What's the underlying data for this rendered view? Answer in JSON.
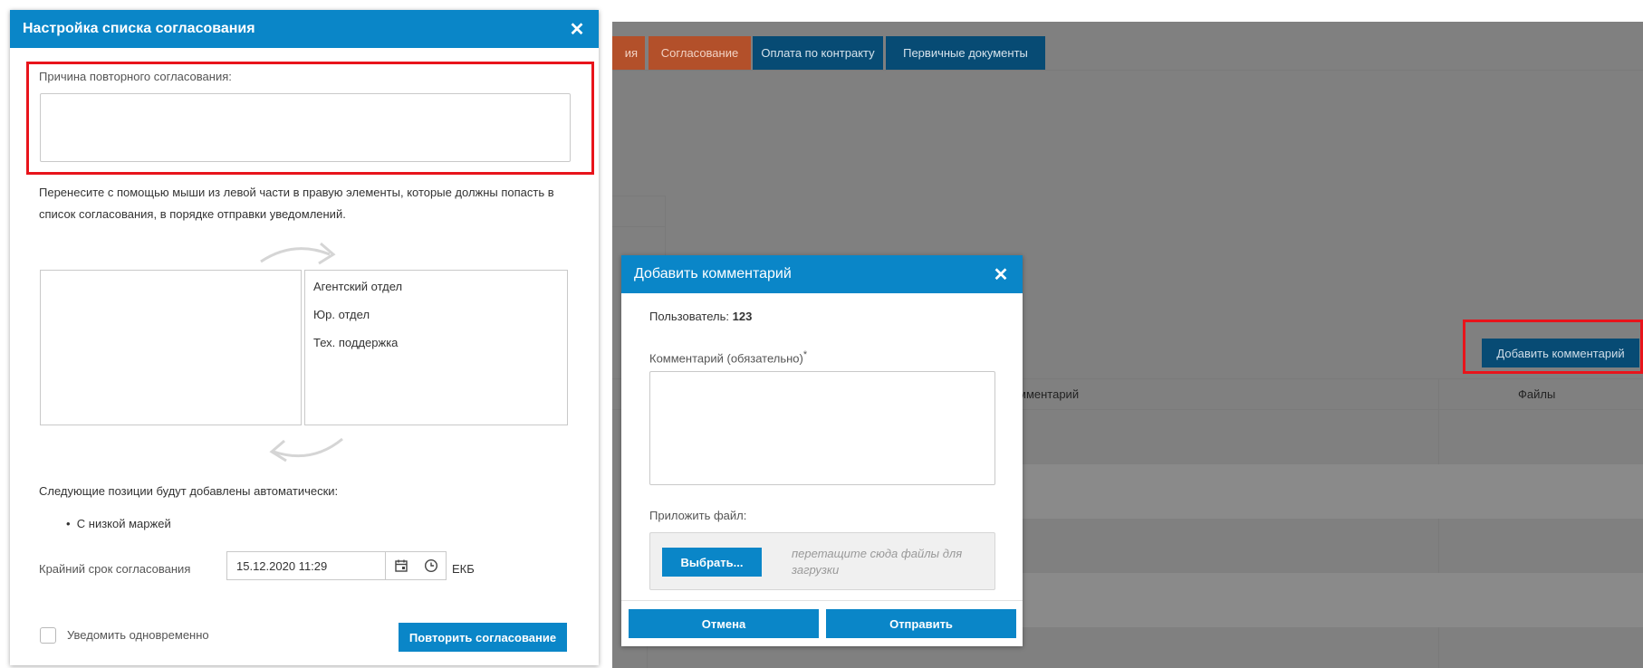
{
  "approval_dialog": {
    "title": "Настройка списка согласования",
    "reason_label": "Причина повторного согласования:",
    "reason_value": "",
    "instructions": "Перенесите с помощью мыши из левой части в правую элементы, которые должны попасть в список согласования, в порядке отправки уведомлений.",
    "left_list": [],
    "right_list": [
      "Агентский отдел",
      "Юр. отдел",
      "Тех. поддержка"
    ],
    "auto_label": "Следующие позиции будут добавлены автоматически:",
    "auto_items": [
      "С низкой маржей"
    ],
    "deadline_label": "Крайний срок согласования",
    "deadline_value": "15.12.2020 11:29",
    "timezone": "ЕКБ",
    "notify_label": "Уведомить одновременно",
    "notify_checked": false,
    "submit_label": "Повторить согласование"
  },
  "comment_dialog": {
    "title": "Добавить комментарий",
    "user_label": "Пользователь:",
    "user_value": "123",
    "comment_label": "Комментарий (обязательно)",
    "required_mark": "*",
    "comment_value": "",
    "attach_label": "Приложить файл:",
    "choose_label": "Выбрать...",
    "drop_hint": "перетащите сюда файлы для загрузки",
    "cancel_label": "Отмена",
    "send_label": "Отправить"
  },
  "background_app": {
    "tabs": [
      "ия",
      "Согласование",
      "Оплата по контракту",
      "Первичные документы"
    ],
    "active_tab": "Согласование",
    "add_comment_label": "Добавить комментарий",
    "columns": [
      "мментарий",
      "Файлы"
    ]
  },
  "icons": {
    "close": "close-icon",
    "calendar": "calendar-icon",
    "clock": "clock-icon",
    "swap_arrows": "curved-arrow-icon"
  },
  "colors": {
    "header_blue": "#0a86c8",
    "highlight_red": "#e8141b",
    "tab_dark": "#074b74",
    "tab_active": "#b3502a",
    "dim_overlay": "#808080"
  }
}
